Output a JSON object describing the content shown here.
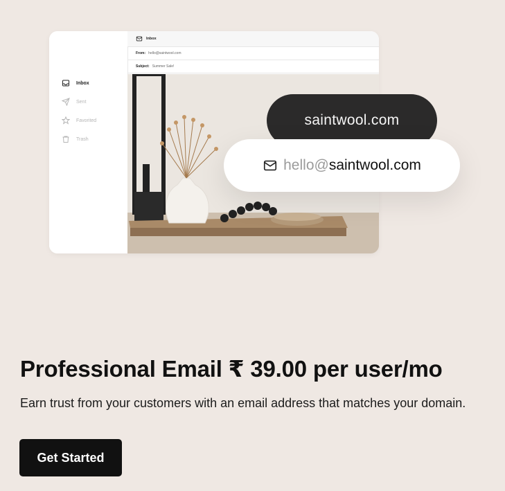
{
  "mockup": {
    "sidebar": {
      "items": [
        {
          "label": "Inbox",
          "icon": "inbox-icon",
          "active": true
        },
        {
          "label": "Sent",
          "icon": "send-icon",
          "active": false
        },
        {
          "label": "Favorited",
          "icon": "star-icon",
          "active": false
        },
        {
          "label": "Trash",
          "icon": "trash-icon",
          "active": false
        }
      ]
    },
    "mail": {
      "header_title": "Inbox",
      "from_label": "From:",
      "from_value": "hello@saintwool.com",
      "subject_label": "Subject:",
      "subject_value": "Summer Sale!"
    }
  },
  "pills": {
    "domain": "saintwool.com",
    "email_local": "hello@",
    "email_domain": "saintwool.com"
  },
  "headline": "Professional Email ₹ 39.00 per user/mo",
  "description": "Earn trust from your customers with an email address that matches your domain.",
  "cta_label": "Get Started",
  "colors": {
    "background": "#efe8e3",
    "dark_pill": "#2b2a2a",
    "button": "#111111"
  }
}
